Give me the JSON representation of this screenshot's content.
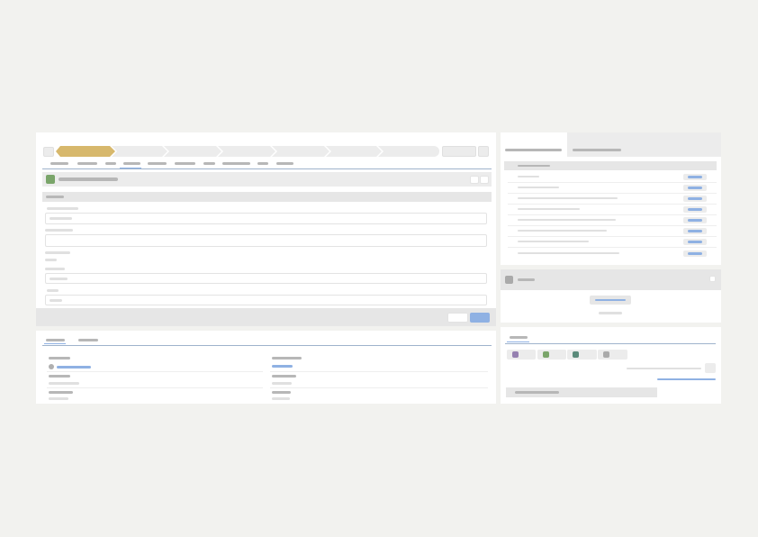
{
  "colors": {
    "background": "#f2f2ef",
    "panel": "#ffffff",
    "header_gray": "#e8e8e8",
    "path_active": "#d7b86c",
    "accent_blue": "#8fb1e3",
    "green": "#7aa56a",
    "purple": "#9580b0",
    "teal": "#5a8a7a",
    "gray_icon": "#aaaaaa"
  },
  "path": {
    "steps_total": 7,
    "active_step": 1
  },
  "tabs": {
    "active_index": 4
  },
  "placeholder_text": ""
}
